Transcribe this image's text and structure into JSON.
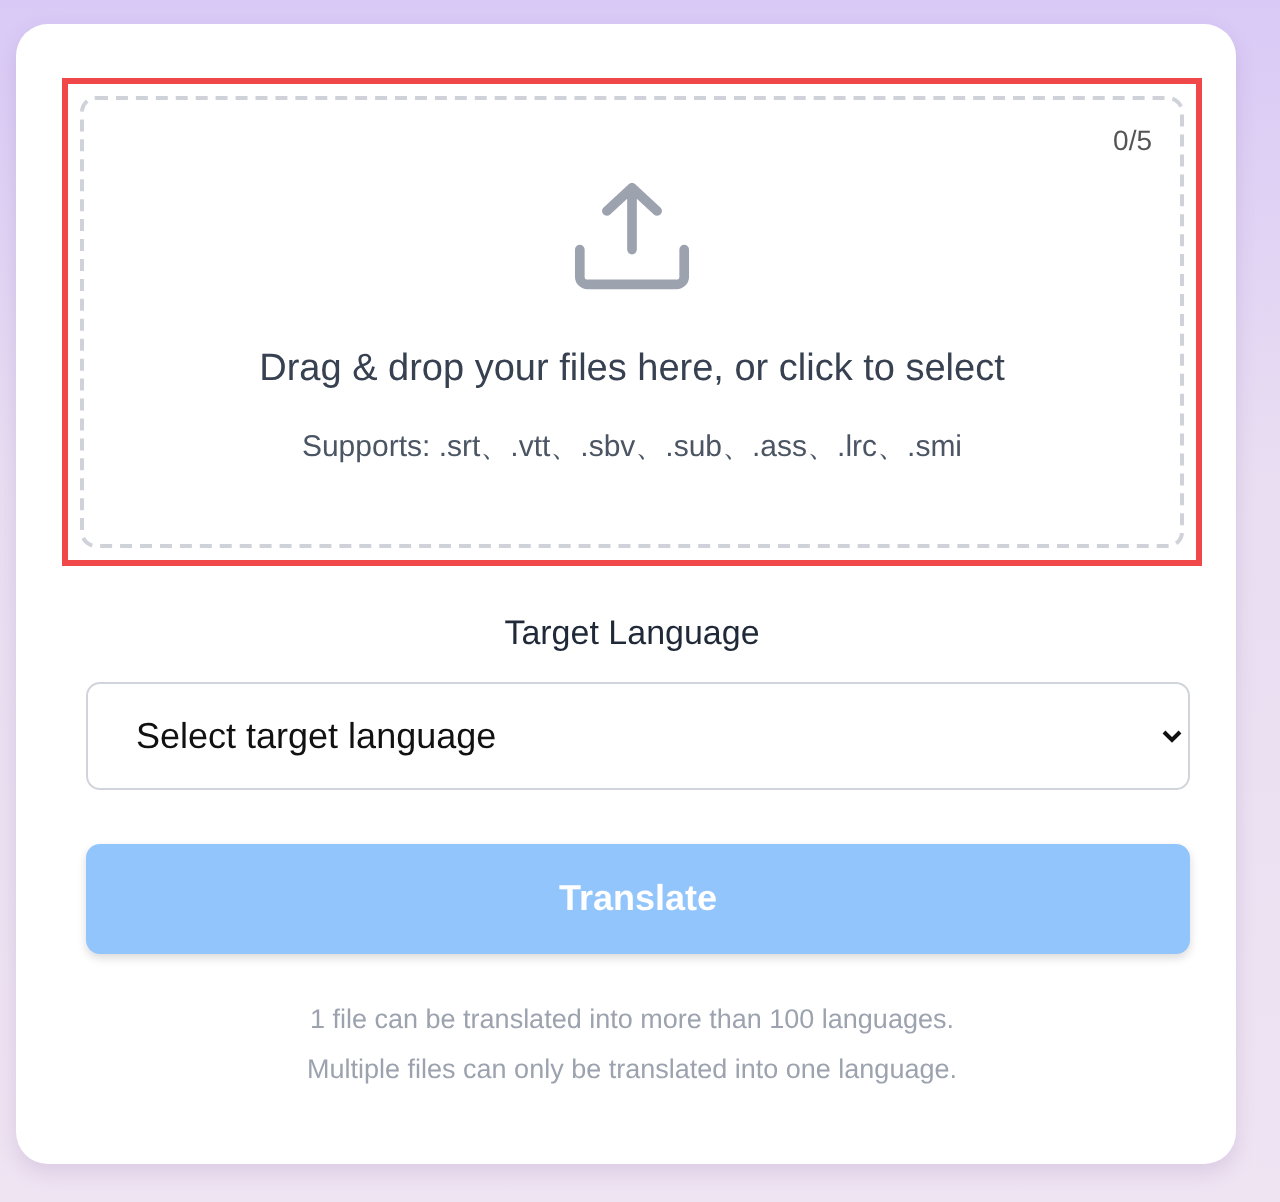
{
  "upload": {
    "highlighted": true,
    "count": "0/5",
    "prompt": "Drag & drop your files here, or click to select",
    "formats": "Supports: .srt、.vtt、.sbv、.sub、.ass、.lrc、.smi"
  },
  "language": {
    "label": "Target Language",
    "placeholder": "Select target language"
  },
  "translate_button": {
    "label": "Translate",
    "disabled": true
  },
  "notes": [
    "1 file can be translated into more than 100 languages.",
    "Multiple files can only be translated into one language."
  ]
}
